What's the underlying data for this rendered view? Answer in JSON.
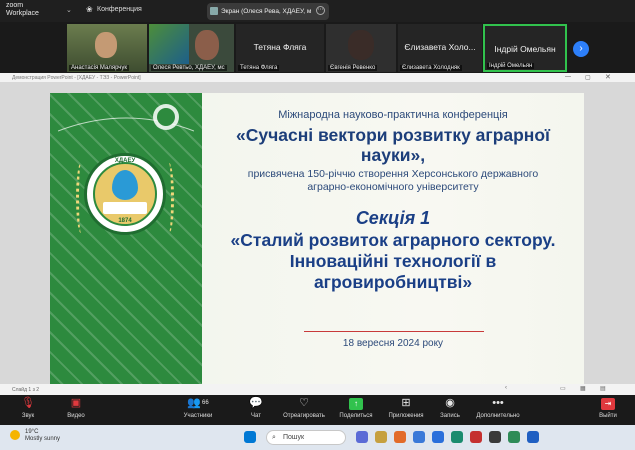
{
  "app": {
    "brand_line1": "zoom",
    "brand_line2": "Workplace",
    "conference_label": "Конференция"
  },
  "share": {
    "label": "Экран (Олеся Рева, ХДАЕУ, м"
  },
  "participants": [
    {
      "name": "Анастасія Малярчук",
      "kind": "video"
    },
    {
      "name": "Олеся Ревтьо, ХДАЕУ, мс",
      "kind": "video"
    },
    {
      "name": "Тетяна Фляга",
      "bigname": "Тетяна Фляга",
      "kind": "name"
    },
    {
      "name": "Євгенія Ревенко",
      "kind": "video"
    },
    {
      "name": "Єлизавета Холодняк",
      "bigname": "Єлизавета Холо...",
      "kind": "name"
    },
    {
      "name": "Індрій Омельян",
      "bigname": "Індрій Омельян",
      "kind": "name",
      "active": true
    }
  ],
  "ppt": {
    "window_title": "Демонстрация PowerPoint - [ХДАЕУ - ТЭЗ - PowerPoint]",
    "status": "Слайд 1 з 2"
  },
  "slide": {
    "line1": "Міжнародна науково-практична конференція",
    "title1": "«Сучасні вектори розвитку аграрної",
    "title2": "науки»,",
    "sub1": "присвячена 150-річчю створення Херсонського державного",
    "sub2": "аграрно-економічного університету",
    "section": "Секція 1",
    "topic1": "«Сталий розвиток аграрного сектору.",
    "topic2": "Інноваційні технології в",
    "topic3": "агровиробництві»",
    "date": "18 вересня 2024 року",
    "logo_text": "ХДАЕУ",
    "logo_year": "1874"
  },
  "controls": {
    "audio": "Звук",
    "video": "Видео",
    "participants": "Участники",
    "participants_count": "66",
    "chat": "Чат",
    "react": "Отреагировать",
    "share": "Поделиться",
    "apps": "Приложения",
    "record": "Запись",
    "more": "Дополнительно",
    "leave": "Выйти"
  },
  "taskbar": {
    "temp": "19°C",
    "weather": "Mostly sunny",
    "search_placeholder": "Пошук"
  },
  "colors": {
    "slide_green": "#2d8a3e",
    "title_blue": "#1c3e7a",
    "zoom_blue": "#2d7ff9",
    "share_green": "#31c24d",
    "leave_red": "#e0393e"
  }
}
